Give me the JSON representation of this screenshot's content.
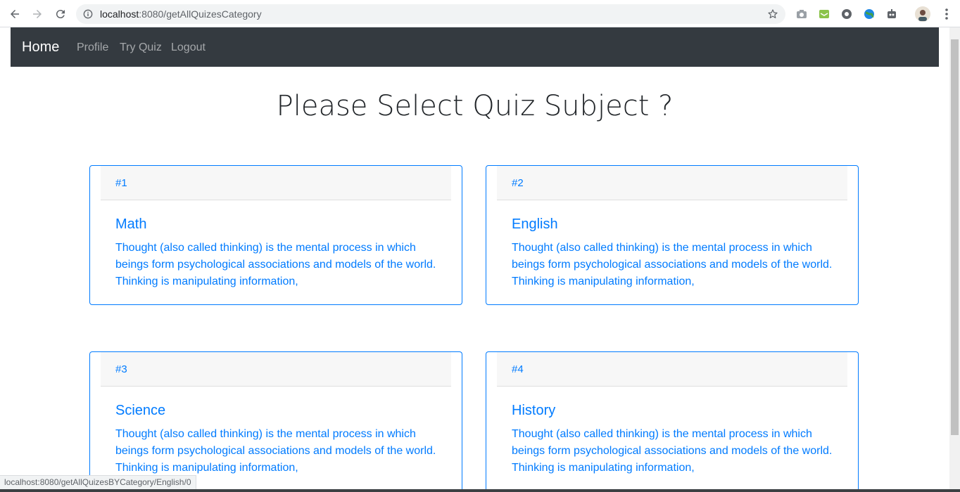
{
  "browser": {
    "url_host": "localhost",
    "url_rest": ":8080/getAllQuizesCategory",
    "status_url": "localhost:8080/getAllQuizesBYCategory/English/0"
  },
  "navbar": {
    "brand": "Home",
    "links": [
      "Profile",
      "Try Quiz",
      "Logout"
    ]
  },
  "page": {
    "title": "Please Select Quiz Subject ?"
  },
  "cards": [
    {
      "number": "#1",
      "title": "Math",
      "text": "Thought (also called thinking) is the mental process in which beings form psychological associations and models of the world. Thinking is manipulating information,"
    },
    {
      "number": "#2",
      "title": "English",
      "text": "Thought (also called thinking) is the mental process in which beings form psychological associations and models of the world. Thinking is manipulating information,"
    },
    {
      "number": "#3",
      "title": "Science",
      "text": "Thought (also called thinking) is the mental process in which beings form psychological associations and models of the world. Thinking is manipulating information,"
    },
    {
      "number": "#4",
      "title": "History",
      "text": "Thought (also called thinking) is the mental process in which beings form psychological associations and models of the world. Thinking is manipulating information,"
    }
  ],
  "icons": {
    "back": "back-arrow-icon",
    "forward": "forward-arrow-icon",
    "reload": "reload-icon",
    "info": "info-icon",
    "bookmark": "star-icon",
    "menu": "kebab-menu-icon"
  },
  "colors": {
    "navbar_bg": "#343a40",
    "accent": "#007bff"
  }
}
